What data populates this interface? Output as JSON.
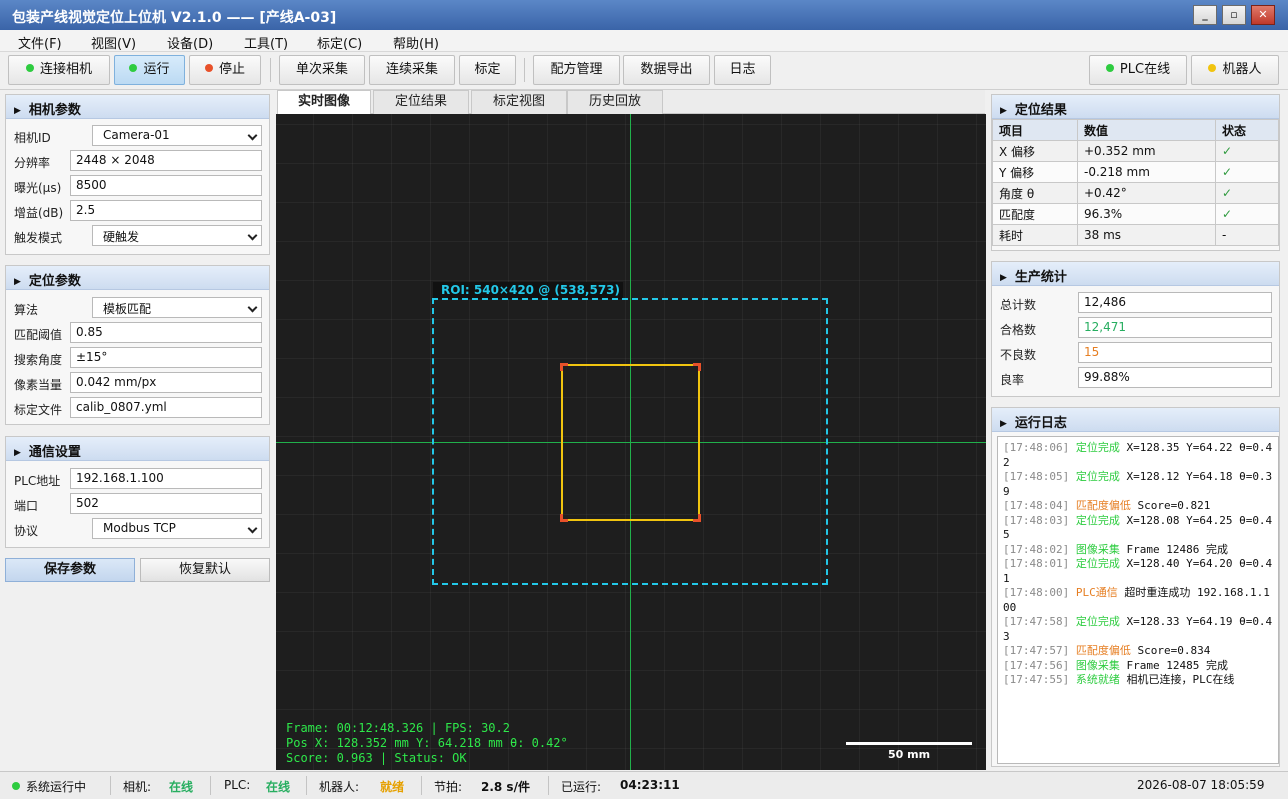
{
  "window": {
    "title": "包装产线视觉定位上位机 V2.1.0 —— [产线A-03]",
    "minimize": "_",
    "maximize": "▫",
    "close": "✕"
  },
  "menu": [
    "文件(F)",
    "视图(V)",
    "设备(D)",
    "工具(T)",
    "标定(C)",
    "帮助(H)"
  ],
  "toolbar": {
    "connect": "连接相机",
    "run": "运行",
    "stop": "停止",
    "single": "单次采集",
    "continuous": "连续采集",
    "calibrate": "标定",
    "recipe": "配方管理",
    "export": "数据导出",
    "log": "日志",
    "plc_online": "PLC在线",
    "robot": "机器人"
  },
  "colors": {
    "green": "#2ecc40",
    "red": "#e74c3c",
    "yellow": "#f1c40f",
    "orange": "#e67e22",
    "cyan": "#23c8e8"
  },
  "camera": {
    "title": "相机参数",
    "fields": {
      "camera_id_label": "相机ID",
      "camera_id": "Camera-01",
      "resolution_label": "分辨率",
      "resolution": "2448 × 2048",
      "exposure_label": "曝光(μs)",
      "exposure": "8500",
      "gain_label": "增益(dB)",
      "gain": "2.5",
      "trigger_label": "触发模式",
      "trigger": "硬触发"
    }
  },
  "locate": {
    "title": "定位参数",
    "algo_label": "算法",
    "algo": "模板匹配",
    "threshold_label": "匹配阈值",
    "threshold": "0.85",
    "angle_label": "搜索角度",
    "angle": "±15°",
    "pixel_label": "像素当量",
    "pixel": "0.042 mm/px",
    "calib_label": "标定文件",
    "calib": "calib_0807.yml"
  },
  "comm": {
    "title": "通信设置",
    "plc_label": "PLC地址",
    "plc": "192.168.1.100",
    "port_label": "端口",
    "port": "502",
    "protocol_label": "协议",
    "protocol": "Modbus TCP"
  },
  "actions": {
    "save": "保存参数",
    "reset": "恢复默认"
  },
  "tabs": [
    "实时图像",
    "定位结果",
    "标定视图",
    "历史回放"
  ],
  "viewer": {
    "roi": "ROI: 540×420 @ (538,573)",
    "overlay": [
      "Frame: 00:12:48.326 | FPS: 30.2",
      "Pos X: 128.352 mm Y: 64.218 mm θ: 0.42°",
      "Score: 0.963 | Status: OK"
    ],
    "scale": "50 mm"
  },
  "result": {
    "title": "定位结果",
    "headers": [
      "项目",
      "数值",
      "状态"
    ],
    "rows": [
      [
        "X 偏移",
        "+0.352 mm",
        "✓"
      ],
      [
        "Y 偏移",
        "-0.218 mm",
        "✓"
      ],
      [
        "角度 θ",
        "+0.42°",
        "✓"
      ],
      [
        "匹配度",
        "96.3%",
        "✓"
      ],
      [
        "耗时",
        "38 ms",
        "-"
      ]
    ]
  },
  "stats": {
    "title": "生产统计",
    "total_label": "总计数",
    "total": "12,486",
    "good_label": "合格数",
    "good": "12,471",
    "bad_label": "不良数",
    "bad": "15",
    "rate_label": "良率",
    "rate": "99.88%"
  },
  "log": {
    "title": "运行日志",
    "entries": [
      {
        "time": "[17:48:06]",
        "tag": "定位完成",
        "type": "ok",
        "msg": "X=128.35 Y=64.22 θ=0.42"
      },
      {
        "time": "[17:48:05]",
        "tag": "定位完成",
        "type": "ok",
        "msg": "X=128.12 Y=64.18 θ=0.39"
      },
      {
        "time": "[17:48:04]",
        "tag": "匹配度偏低",
        "type": "warn",
        "msg": "Score=0.821"
      },
      {
        "time": "[17:48:03]",
        "tag": "定位完成",
        "type": "ok",
        "msg": "X=128.08 Y=64.25 θ=0.45"
      },
      {
        "time": "[17:48:02]",
        "tag": "图像采集",
        "type": "ok",
        "msg": "Frame 12486 完成"
      },
      {
        "time": "[17:48:01]",
        "tag": "定位完成",
        "type": "ok",
        "msg": "X=128.40 Y=64.20 θ=0.41"
      },
      {
        "time": "[17:48:00]",
        "tag": "PLC通信",
        "type": "warn",
        "msg": "超时重连成功 192.168.1.100"
      },
      {
        "time": "[17:47:58]",
        "tag": "定位完成",
        "type": "ok",
        "msg": "X=128.33 Y=64.19 θ=0.43"
      },
      {
        "time": "[17:47:57]",
        "tag": "匹配度偏低",
        "type": "warn",
        "msg": "Score=0.834"
      },
      {
        "time": "[17:47:56]",
        "tag": "图像采集",
        "type": "ok",
        "msg": "Frame 12485 完成"
      },
      {
        "time": "[17:47:55]",
        "tag": "系统就绪",
        "type": "ok",
        "msg": "相机已连接，PLC在线"
      }
    ]
  },
  "status": {
    "running": "系统运行中",
    "camera_label": "相机:",
    "camera": "在线",
    "plc_label": "PLC:",
    "plc": "在线",
    "robot_label": "机器人:",
    "robot": "就绪",
    "cycle_label": "节拍:",
    "cycle": "2.8 s/件",
    "uptime_label": "已运行:",
    "uptime": "04:23:11",
    "datetime": "2026-08-07 18:05:59"
  }
}
